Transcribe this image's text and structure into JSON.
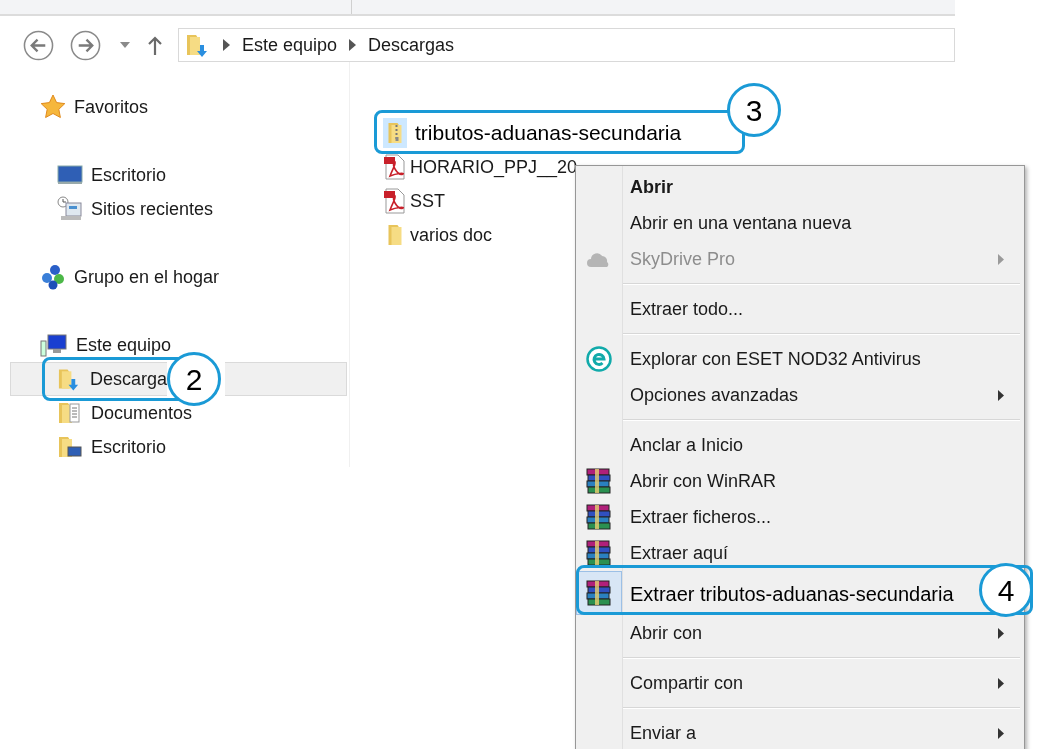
{
  "address_bar": {
    "path": [
      "Este equipo",
      "Descargas"
    ]
  },
  "sidebar": {
    "groups": [
      {
        "label": "Favoritos",
        "kind": "favorites",
        "children": [
          {
            "label": "Escritorio",
            "kind": "desktop",
            "selected": false
          },
          {
            "label": "Sitios recientes",
            "kind": "recent",
            "selected": false
          }
        ]
      },
      {
        "label": "Grupo en el hogar",
        "kind": "homegroup"
      },
      {
        "label": "Este equipo",
        "kind": "computer",
        "children": [
          {
            "label": "Descarga",
            "kind": "downloads",
            "selected": true,
            "callout": "2"
          },
          {
            "label": "Documentos",
            "kind": "documents",
            "selected": false
          },
          {
            "label": "Escritorio",
            "kind": "desktop-folder",
            "selected": false
          }
        ]
      }
    ]
  },
  "files": [
    {
      "name": "tributos-aduanas-secundaria",
      "kind": "zip",
      "selected": true,
      "callout": "3"
    },
    {
      "name": "HORARIO_PPJ__20",
      "kind": "pdf",
      "selected": false
    },
    {
      "name": "SST",
      "kind": "pdf",
      "selected": false
    },
    {
      "name": "varios doc",
      "kind": "folder",
      "selected": false
    }
  ],
  "context_menu": {
    "items": [
      {
        "kind": "plain",
        "label": "Abrir",
        "default": true
      },
      {
        "kind": "plain",
        "label": "Abrir en una ventana nueva"
      },
      {
        "kind": "cloud",
        "label": "SkyDrive Pro",
        "disabled": true,
        "submenu": true
      },
      {
        "kind": "separator"
      },
      {
        "kind": "plain",
        "label": "Extraer todo..."
      },
      {
        "kind": "separator"
      },
      {
        "kind": "eset",
        "label": "Explorar con ESET NOD32 Antivirus"
      },
      {
        "kind": "plain",
        "label": "Opciones avanzadas",
        "submenu": true
      },
      {
        "kind": "separator"
      },
      {
        "kind": "plain",
        "label": "Anclar a Inicio"
      },
      {
        "kind": "winrar",
        "label": "Abrir con WinRAR"
      },
      {
        "kind": "winrar",
        "label": "Extraer ficheros..."
      },
      {
        "kind": "winrar",
        "label": "Extraer aquí"
      },
      {
        "kind": "winrar",
        "label": "Extraer tributos-aduanas-secundaria",
        "selected": true,
        "callout": "4"
      },
      {
        "kind": "plain",
        "label": "Abrir con",
        "submenu": true
      },
      {
        "kind": "separator"
      },
      {
        "kind": "plain",
        "label": "Compartir con",
        "submenu": true
      },
      {
        "kind": "separator"
      },
      {
        "kind": "plain",
        "label": "Enviar a",
        "submenu": true
      }
    ]
  }
}
